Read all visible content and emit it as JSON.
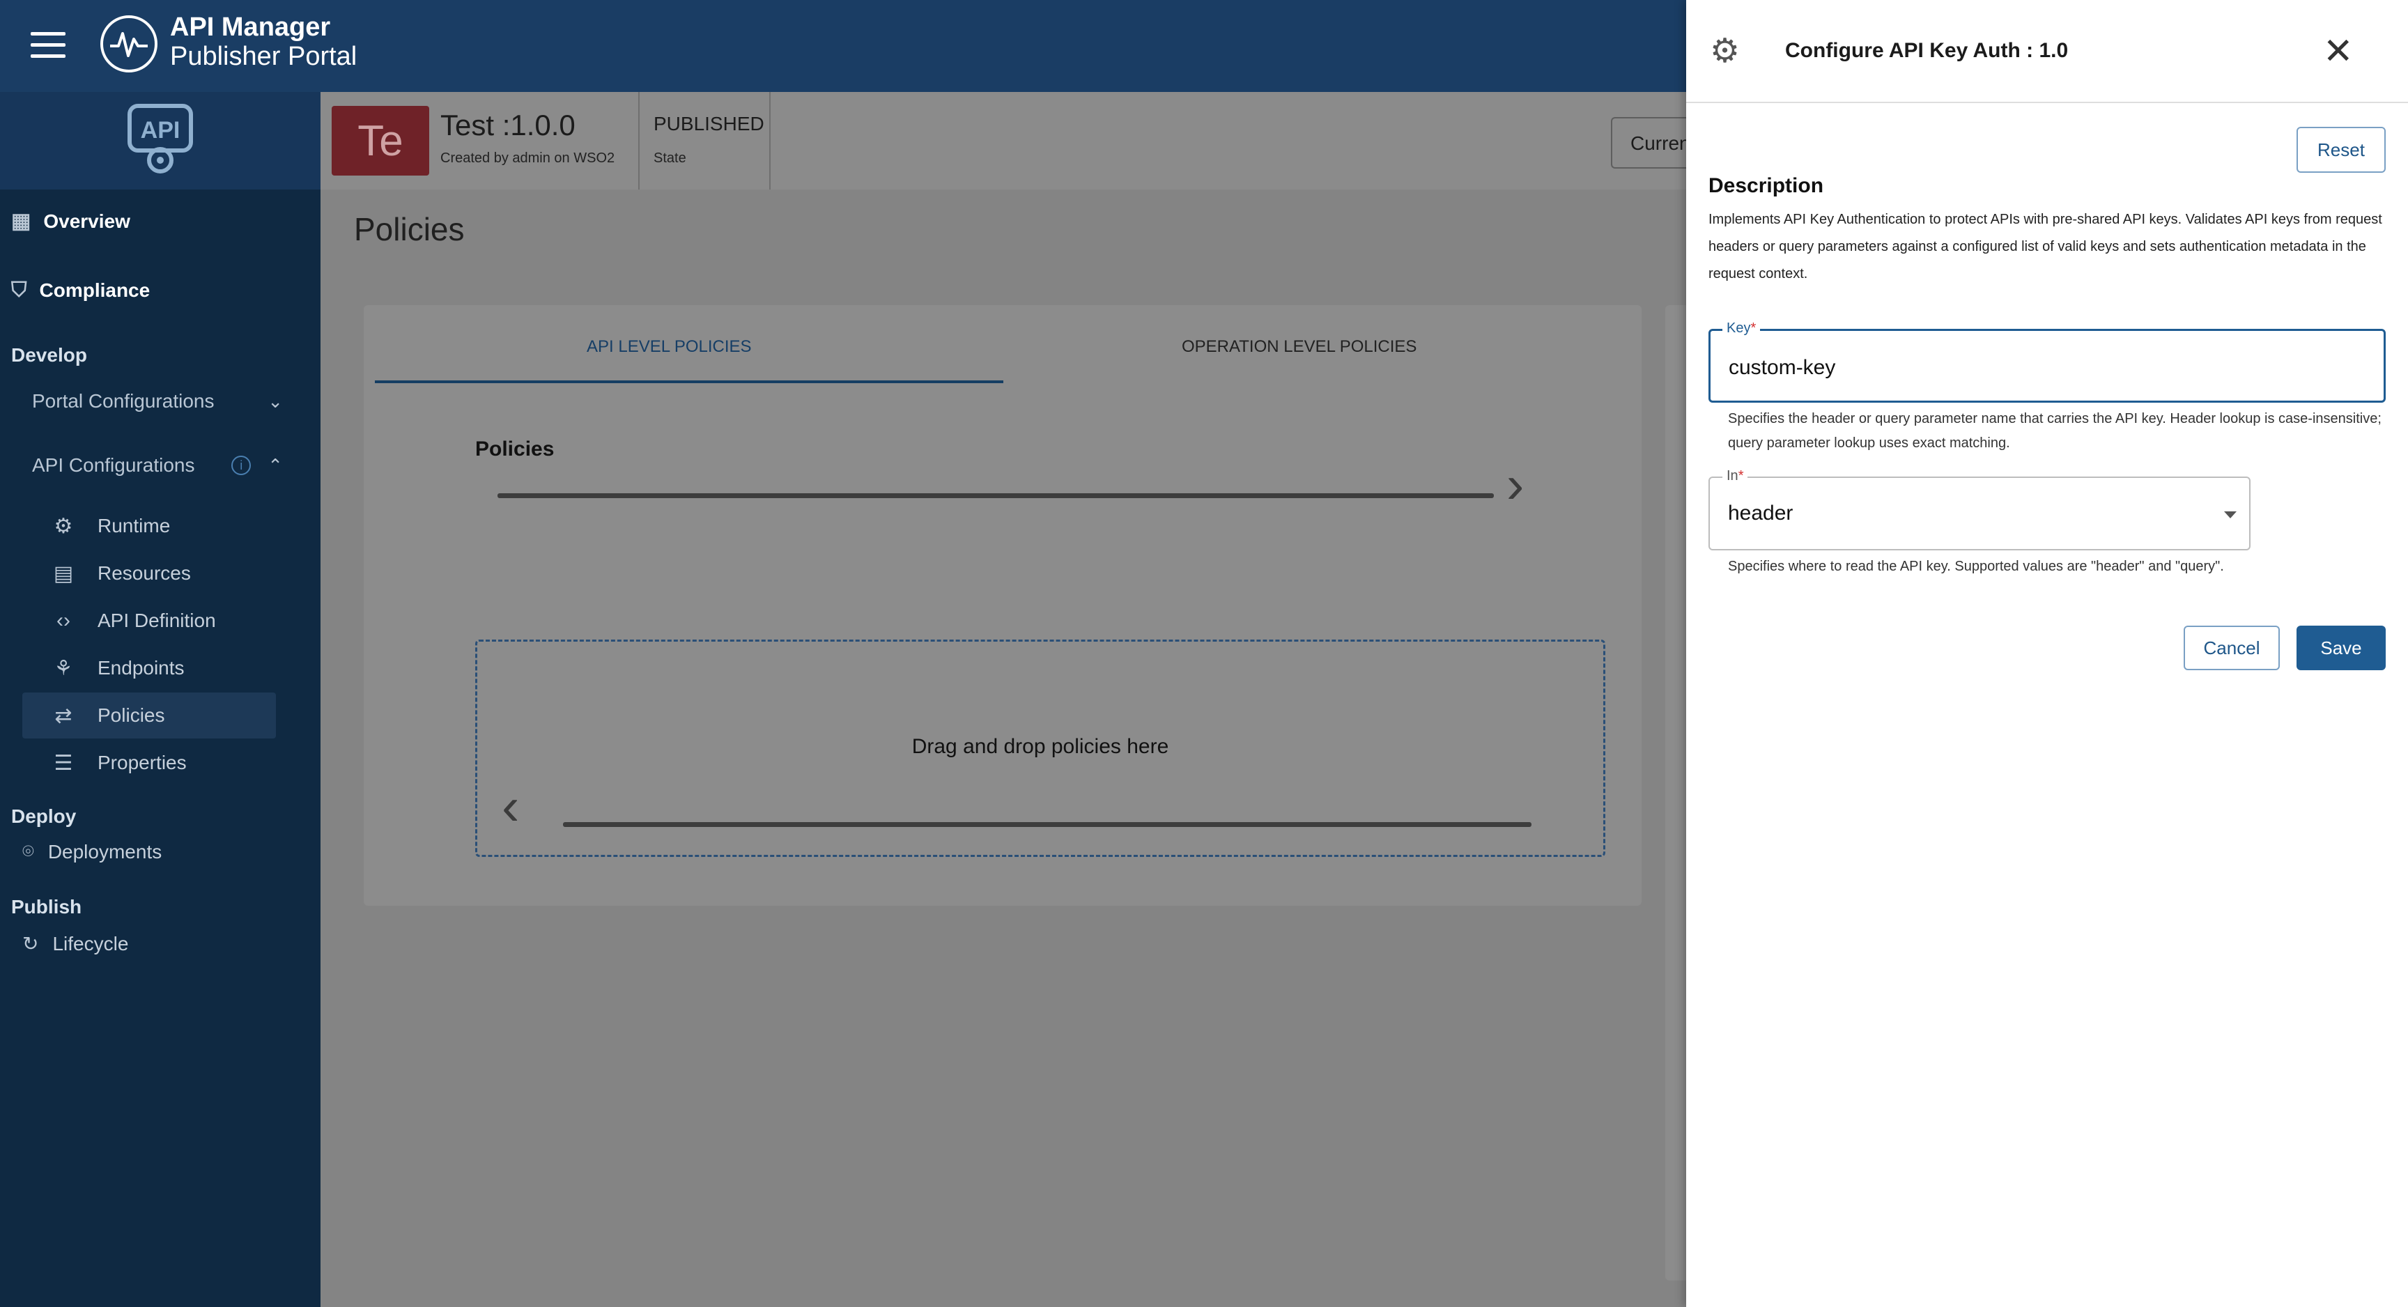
{
  "app": {
    "title_line1": "API Manager",
    "title_line2": "Publisher Portal"
  },
  "sidebar": {
    "logo_text": "API",
    "top_items": [
      {
        "label": "Overview",
        "icon": "dashboard-icon"
      },
      {
        "label": "Compliance",
        "icon": "shield-icon"
      }
    ],
    "sections": {
      "develop": "Develop",
      "deploy": "Deploy",
      "publish": "Publish"
    },
    "groups": {
      "portal_configurations": "Portal Configurations",
      "api_configurations": "API Configurations"
    },
    "api_config_items": [
      {
        "label": "Runtime",
        "icon": "gear-icon"
      },
      {
        "label": "Resources",
        "icon": "resources-icon"
      },
      {
        "label": "API Definition",
        "icon": "code-icon"
      },
      {
        "label": "Endpoints",
        "icon": "endpoints-icon"
      },
      {
        "label": "Policies",
        "icon": "swap-arrows-icon",
        "active": true
      },
      {
        "label": "Properties",
        "icon": "list-icon"
      }
    ],
    "deployments": "Deployments",
    "lifecycle": "Lifecycle"
  },
  "api_header": {
    "avatar": "Te",
    "name": "Test :1.0.0",
    "created_by": "Created by admin on WSO2",
    "state_value": "PUBLISHED",
    "state_label": "State",
    "current_button": "Curren"
  },
  "main": {
    "page_title": "Policies",
    "tabs": [
      "API LEVEL POLICIES",
      "OPERATION LEVEL POLICIES"
    ],
    "policies_heading": "Policies",
    "dropzone_text": "Drag and drop policies here"
  },
  "drawer": {
    "title": "Configure API Key Auth : 1.0",
    "reset_label": "Reset",
    "description_heading": "Description",
    "description_text": "Implements API Key Authentication to protect APIs with pre-shared API keys. Validates API keys from request headers or query parameters against a configured list of valid keys and sets authentication metadata in the request context.",
    "key_field": {
      "label": "Key",
      "value": "custom-key",
      "helper": "Specifies the header or query parameter name that carries the API key. Header lookup is case-insensitive; query parameter lookup uses exact matching."
    },
    "in_field": {
      "label": "In",
      "value": "header",
      "helper": "Specifies where to read the API key. Supported values are \"header\" and \"query\"."
    },
    "cancel_label": "Cancel",
    "save_label": "Save"
  },
  "colors": {
    "header_bg": "#1a3d64",
    "sidebar_bg": "#0f2942",
    "primary": "#1f5c92",
    "avatar_bg": "#6f2228",
    "required": "#d32f2f"
  }
}
